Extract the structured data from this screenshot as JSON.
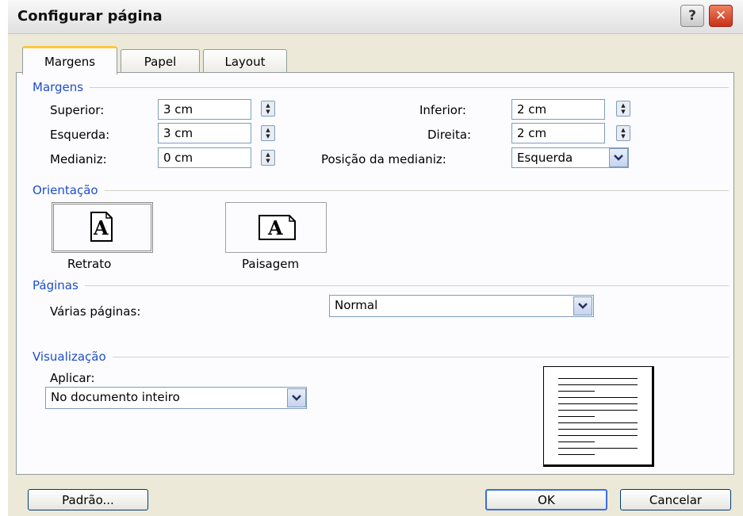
{
  "window": {
    "title": "Configurar página",
    "help_label": "?",
    "close_label": "✕"
  },
  "tabs": [
    {
      "label": "Margens",
      "active": true
    },
    {
      "label": "Papel",
      "active": false
    },
    {
      "label": "Layout",
      "active": false
    }
  ],
  "margens": {
    "heading": "Margens",
    "superior": {
      "label": "Superior:",
      "value": "3 cm"
    },
    "inferior": {
      "label": "Inferior:",
      "value": "2 cm"
    },
    "esquerda": {
      "label": "Esquerda:",
      "value": "3 cm"
    },
    "direita": {
      "label": "Direita:",
      "value": "2 cm"
    },
    "medianiz": {
      "label": "Medianiz:",
      "value": "0 cm"
    },
    "posicao": {
      "label": "Posição da medianiz:",
      "value": "Esquerda"
    }
  },
  "orientacao": {
    "heading": "Orientação",
    "retrato": {
      "label": "Retrato",
      "glyph": "A",
      "selected": true
    },
    "paisagem": {
      "label": "Paisagem",
      "glyph": "A",
      "selected": false
    }
  },
  "paginas": {
    "heading": "Páginas",
    "label": "Várias páginas:",
    "value": "Normal"
  },
  "visualizacao": {
    "heading": "Visualização",
    "apply_label": "Aplicar:",
    "apply_value": "No documento inteiro"
  },
  "buttons": {
    "padrao": "Padrão...",
    "ok": "OK",
    "cancelar": "Cancelar"
  },
  "colors": {
    "section_heading": "#1c4ecb",
    "dialog_bg": "#ece9d8",
    "active_tab_accent": "#ffc83c",
    "close_button": "#c83018"
  },
  "icons": [
    "help-icon",
    "close-icon",
    "spin-updown-icon",
    "chevron-down-icon",
    "portrait-page-icon",
    "landscape-page-icon",
    "page-preview-icon"
  ]
}
